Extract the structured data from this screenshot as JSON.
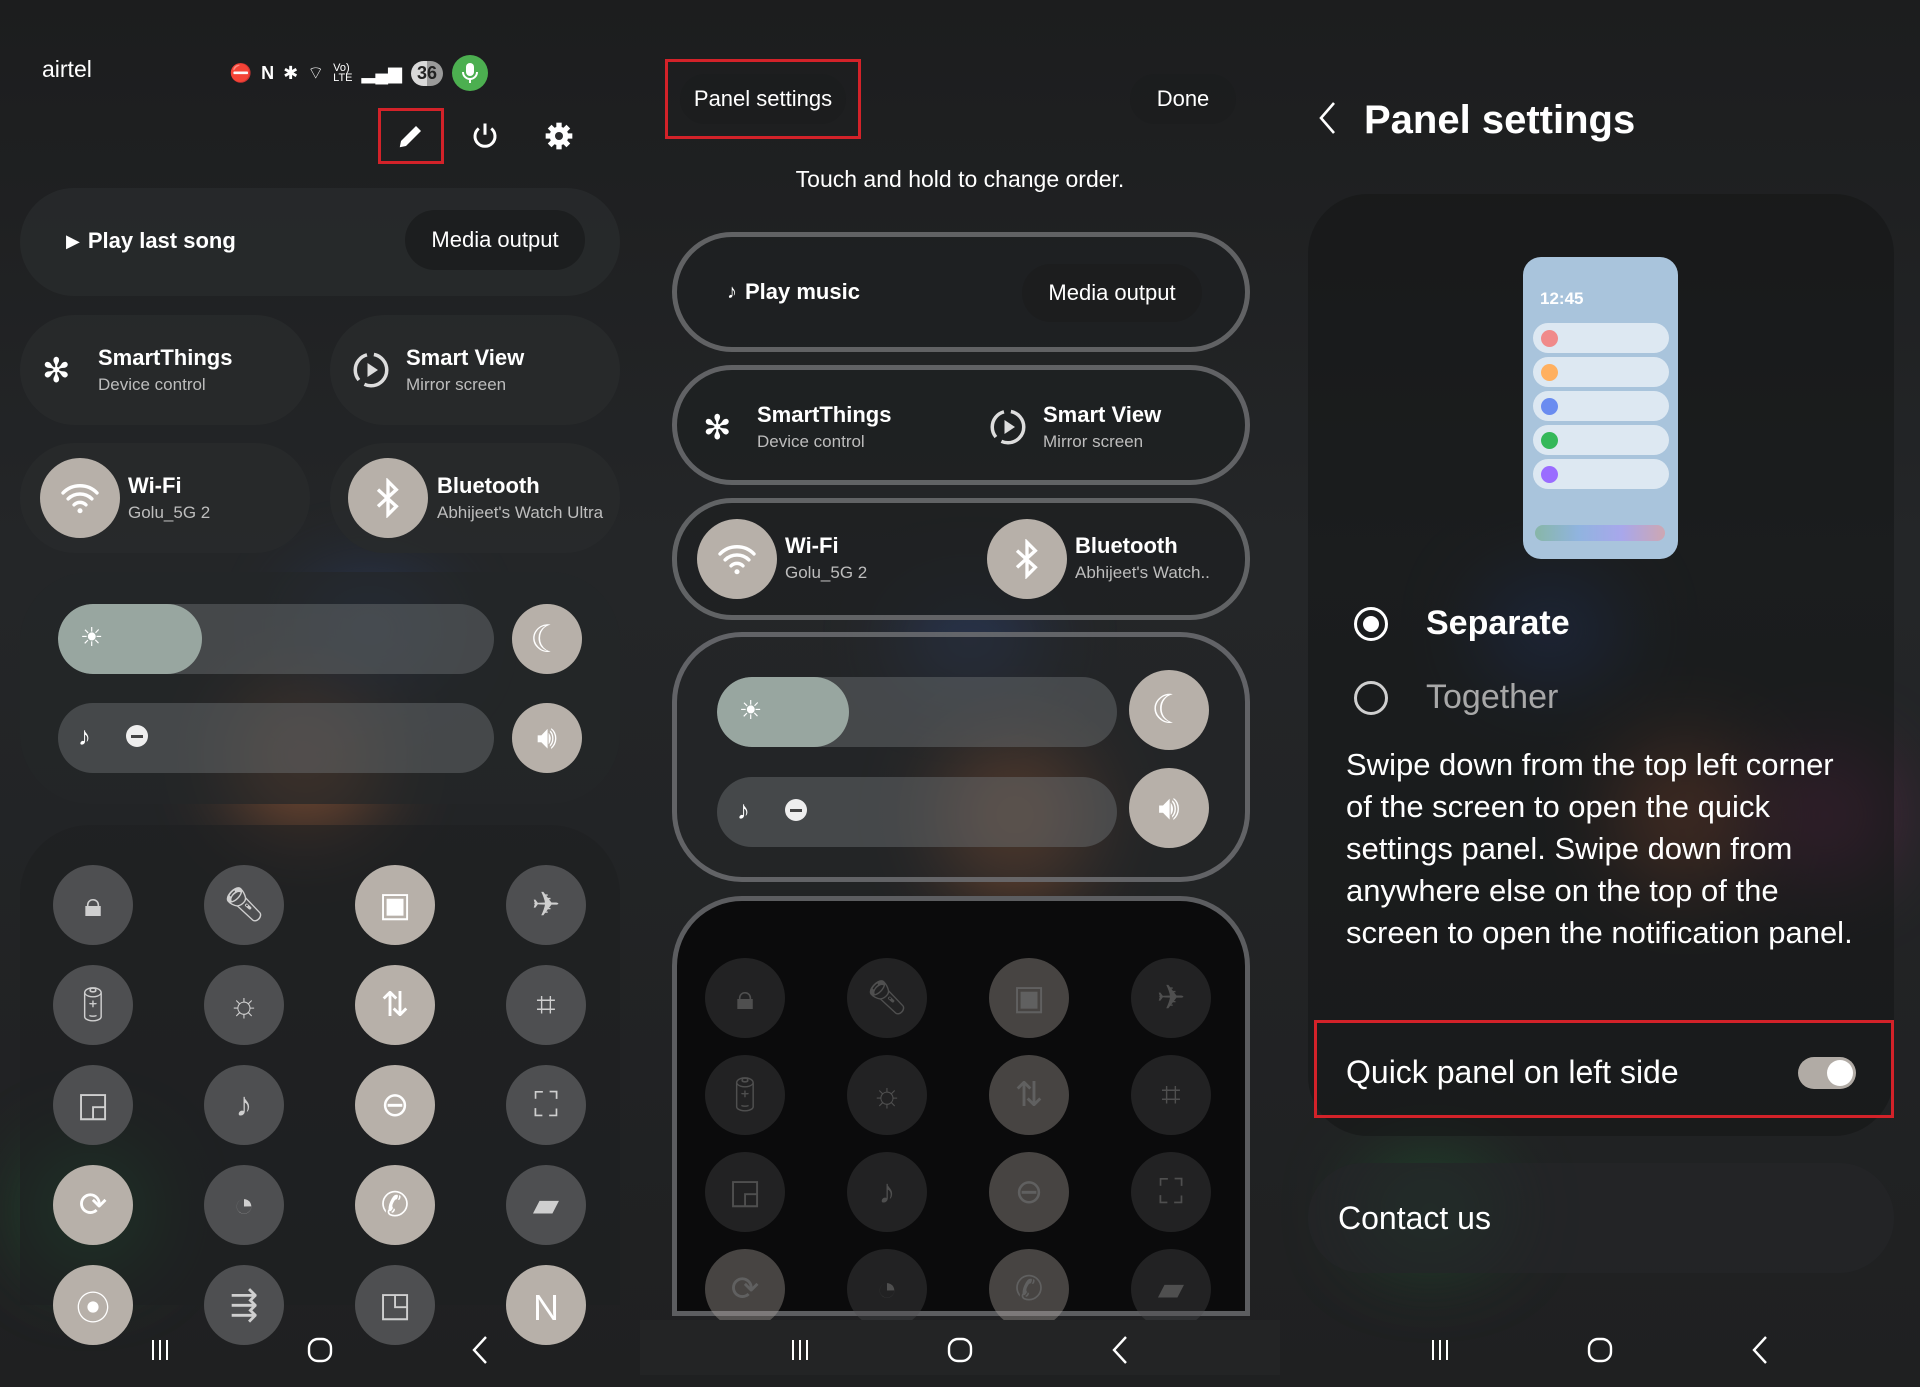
{
  "screen1": {
    "carrier": "airtel",
    "status_icons": [
      "do-not-disturb-icon",
      "nfc-icon",
      "bluetooth-icon",
      "wifi6-icon",
      "volte-icon",
      "signal-icon"
    ],
    "battery_level": "36",
    "top_actions": [
      "edit-icon",
      "power-icon",
      "settings-icon"
    ],
    "media": {
      "play_label": "Play last song",
      "output_label": "Media output"
    },
    "smartthings": {
      "title": "SmartThings",
      "subtitle": "Device control"
    },
    "smartview": {
      "title": "Smart View",
      "subtitle": "Mirror screen"
    },
    "wifi": {
      "title": "Wi-Fi",
      "subtitle": "Golu_5G 2",
      "on": true
    },
    "bluetooth": {
      "title": "Bluetooth",
      "subtitle": "Abhijeet's Watch Ultra",
      "on": true
    },
    "brightness_level": 0.33,
    "volume_level": 0.0,
    "tiles": [
      {
        "name": "secure-folder-icon",
        "on": false
      },
      {
        "name": "flashlight-icon",
        "on": false
      },
      {
        "name": "device-link-icon",
        "on": true
      },
      {
        "name": "airplane-mode-icon",
        "on": false
      },
      {
        "name": "power-saving-icon",
        "on": false
      },
      {
        "name": "eye-comfort-icon",
        "on": false
      },
      {
        "name": "mobile-data-icon",
        "on": true
      },
      {
        "name": "qr-scanner-icon",
        "on": false
      },
      {
        "name": "cast-icon",
        "on": false
      },
      {
        "name": "music-share-icon",
        "on": false
      },
      {
        "name": "do-not-disturb-icon",
        "on": true
      },
      {
        "name": "screen-recorder-icon",
        "on": false
      },
      {
        "name": "sync-icon",
        "on": true
      },
      {
        "name": "data-usage-icon",
        "on": false
      },
      {
        "name": "wifi-calling-icon",
        "on": true
      },
      {
        "name": "private-folder-icon",
        "on": false
      },
      {
        "name": "location-icon",
        "on": true
      },
      {
        "name": "quick-share-icon",
        "on": false
      },
      {
        "name": "multi-window-icon",
        "on": false
      },
      {
        "name": "nfc-icon",
        "on": true
      }
    ]
  },
  "screen2": {
    "panel_settings_label": "Panel settings",
    "done_label": "Done",
    "hint": "Touch and hold to change order.",
    "media": {
      "play_label": "Play music",
      "output_label": "Media output"
    },
    "smartthings": {
      "title": "SmartThings",
      "subtitle": "Device control"
    },
    "smartview": {
      "title": "Smart View",
      "subtitle": "Mirror screen"
    },
    "wifi": {
      "title": "Wi-Fi",
      "subtitle": "Golu_5G 2"
    },
    "bluetooth": {
      "title": "Bluetooth",
      "subtitle": "Abhijeet's Watch.."
    },
    "brightness_level": 0.33
  },
  "screen3": {
    "title": "Panel settings",
    "preview_time": "12:45",
    "preview_dot_colors": [
      "#f08a8a",
      "#ffb060",
      "#6a8cf0",
      "#34b85a",
      "#9a6cff"
    ],
    "options": [
      {
        "label": "Separate",
        "selected": true
      },
      {
        "label": "Together",
        "selected": false
      }
    ],
    "description": "Swipe down from the top left corner of the screen to open the quick settings panel. Swipe down from anywhere else on the top of the screen to open the notification panel.",
    "toggle_label": "Quick panel on left side",
    "toggle_on": true,
    "contact_label": "Contact us"
  },
  "nav": [
    "recent-apps-icon",
    "home-icon",
    "back-icon"
  ],
  "colors": {
    "highlight": "#d32229",
    "tile_on": "#b7b0a9",
    "tile_off": "#4e4f51"
  }
}
